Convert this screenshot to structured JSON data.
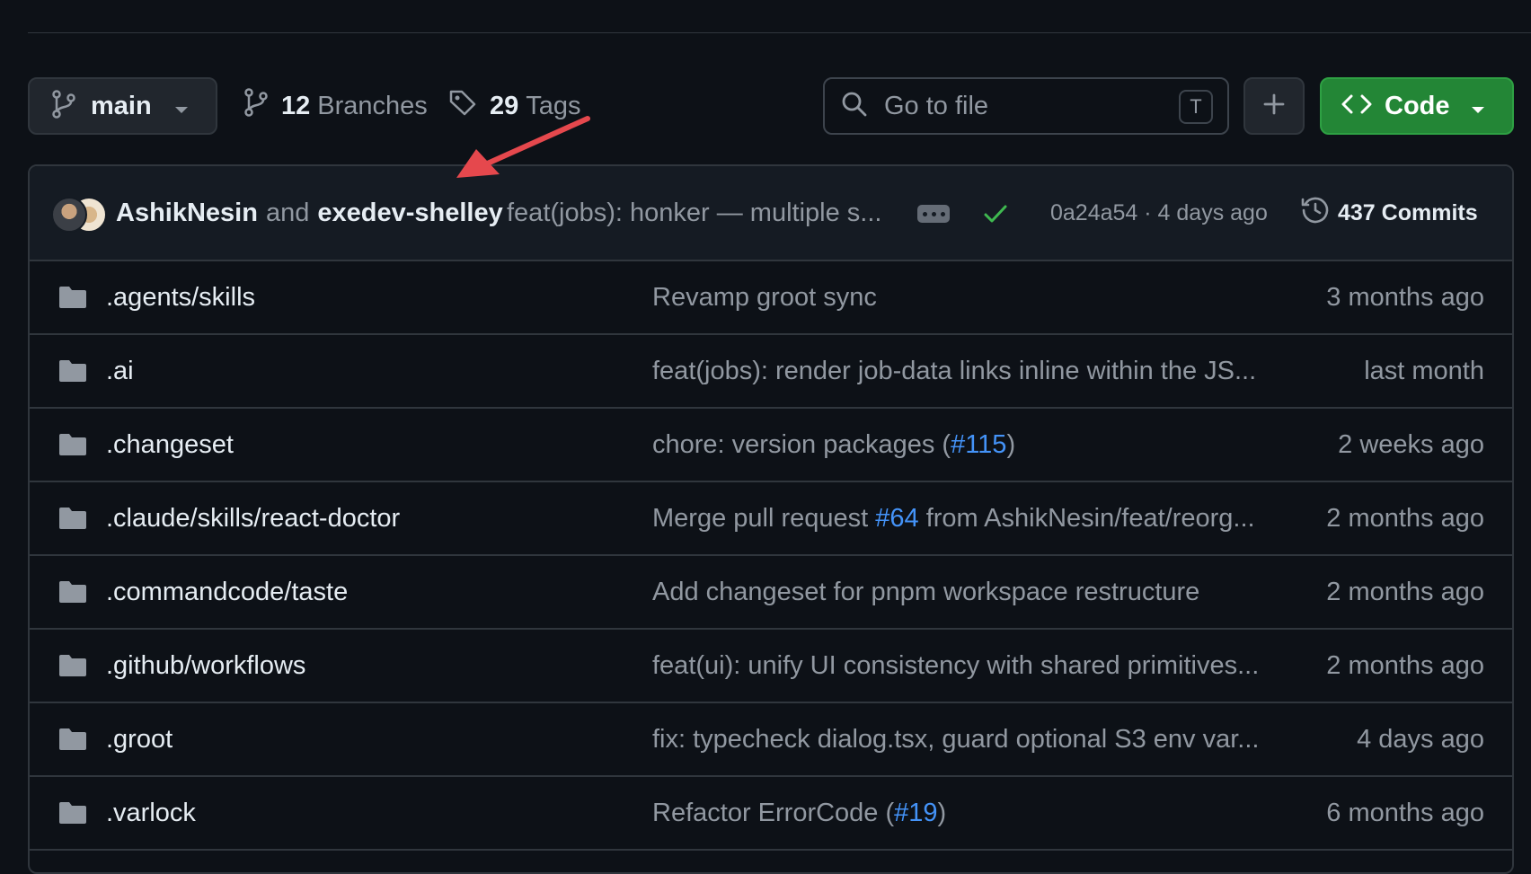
{
  "toolbar": {
    "branch": "main",
    "branches_count": "12",
    "branches_label": "Branches",
    "tags_count": "29",
    "tags_label": "Tags",
    "search_placeholder": "Go to file",
    "search_shortcut": "T",
    "code_label": "Code"
  },
  "commit": {
    "author1": "AshikNesin",
    "and_text": "and",
    "author2": "exedev-shelley",
    "message": "feat(jobs): honker — multiple s...",
    "sha_time": "0a24a54 · 4 days ago",
    "commits_label": "437 Commits"
  },
  "files": [
    {
      "name": ".agents/skills",
      "msg": "Revamp groot sync",
      "pr": "",
      "msg_after": "",
      "time": "3 months ago"
    },
    {
      "name": ".ai",
      "msg": "feat(jobs): render job-data links inline within the JS...",
      "pr": "",
      "msg_after": "",
      "time": "last month"
    },
    {
      "name": ".changeset",
      "msg": "chore: version packages (",
      "pr": "#115",
      "msg_after": ")",
      "time": "2 weeks ago"
    },
    {
      "name": ".claude/skills/react-doctor",
      "msg": "Merge pull request ",
      "pr": "#64",
      "msg_after": " from AshikNesin/feat/reorg...",
      "time": "2 months ago"
    },
    {
      "name": ".commandcode/taste",
      "msg": "Add changeset for pnpm workspace restructure",
      "pr": "",
      "msg_after": "",
      "time": "2 months ago"
    },
    {
      "name": ".github/workflows",
      "msg": "feat(ui): unify UI consistency with shared primitives...",
      "pr": "",
      "msg_after": "",
      "time": "2 months ago"
    },
    {
      "name": ".groot",
      "msg": "fix: typecheck dialog.tsx, guard optional S3 env var...",
      "pr": "",
      "msg_after": "",
      "time": "4 days ago"
    },
    {
      "name": ".varlock",
      "msg": "Refactor ErrorCode (",
      "pr": "#19",
      "msg_after": ")",
      "time": "6 months ago"
    }
  ],
  "colors": {
    "background": "#0d1117",
    "accent_green": "#238636",
    "link_blue": "#4493f8",
    "annotation_arrow": "#e5484d"
  }
}
